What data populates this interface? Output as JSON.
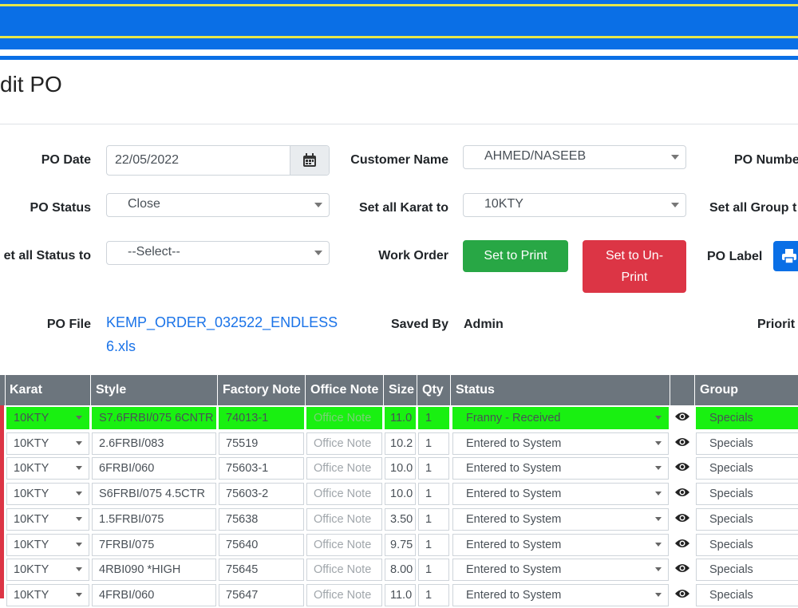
{
  "page": {
    "title": "dit PO"
  },
  "form": {
    "po_date": {
      "label": "PO Date",
      "value": "22/05/2022"
    },
    "customer_name": {
      "label": "Customer Name",
      "value": "AHMED/NASEEB"
    },
    "po_number": {
      "label": "PO Numbe"
    },
    "po_status": {
      "label": "PO Status",
      "value": "Close"
    },
    "set_all_karat": {
      "label": "Set all Karat to",
      "value": "10KTY"
    },
    "set_all_group": {
      "label": "Set all Group t"
    },
    "set_all_status": {
      "label": "et all Status to",
      "value": "--Select--"
    },
    "work_order": {
      "label": "Work Order",
      "print_label": "Set to Print",
      "unprint_line1": "Set to Un-",
      "unprint_line2": "Print"
    },
    "po_label": {
      "label": "PO Label"
    },
    "po_file": {
      "label": "PO File",
      "link_line1": "KEMP_ORDER_032522_ENDLESS",
      "link_line2": "6.xls"
    },
    "saved_by": {
      "label": "Saved By",
      "value": "Admin"
    },
    "priority": {
      "label": "Priorit"
    }
  },
  "table": {
    "headers": [
      "Karat",
      "Style",
      "Factory Note",
      "Office Note",
      "Size",
      "Qty",
      "Status",
      "",
      "Group"
    ],
    "office_placeholder": "Office Note",
    "rows": [
      {
        "karat": "10KTY",
        "style": "S7.6FRBI/075 6CNTR",
        "factory": "74013-1",
        "size": "11.0",
        "qty": "1",
        "status": "Franny - Received",
        "group": "Specials"
      },
      {
        "karat": "10KTY",
        "style": "2.6FRBI/083",
        "factory": "75519",
        "size": "10.2",
        "qty": "1",
        "status": "Entered to System",
        "group": "Specials"
      },
      {
        "karat": "10KTY",
        "style": "6FRBI/060",
        "factory": "75603-1",
        "size": "10.0",
        "qty": "1",
        "status": "Entered to System",
        "group": "Specials"
      },
      {
        "karat": "10KTY",
        "style": "S6FRBI/075 4.5CTR",
        "factory": "75603-2",
        "size": "10.0",
        "qty": "1",
        "status": "Entered to System",
        "group": "Specials"
      },
      {
        "karat": "10KTY",
        "style": "1.5FRBI/075",
        "factory": "75638",
        "size": "3.50",
        "qty": "1",
        "status": "Entered to System",
        "group": "Specials"
      },
      {
        "karat": "10KTY",
        "style": "7FRBI/075",
        "factory": "75640",
        "size": "9.75",
        "qty": "1",
        "status": "Entered to System",
        "group": "Specials"
      },
      {
        "karat": "10KTY",
        "style": "4RBI090 *HIGH",
        "factory": "75645",
        "size": "8.00",
        "qty": "1",
        "status": "Entered to System",
        "group": "Specials"
      },
      {
        "karat": "10KTY",
        "style": "4FRBI/060",
        "factory": "75647",
        "size": "11.0",
        "qty": "1",
        "status": "Entered to System",
        "group": "Specials"
      }
    ]
  },
  "colors": {
    "header_blue": "#0a6fe6",
    "highlight_green": "#19f011",
    "print_green": "#28a745",
    "unprint_red": "#dc3545"
  }
}
